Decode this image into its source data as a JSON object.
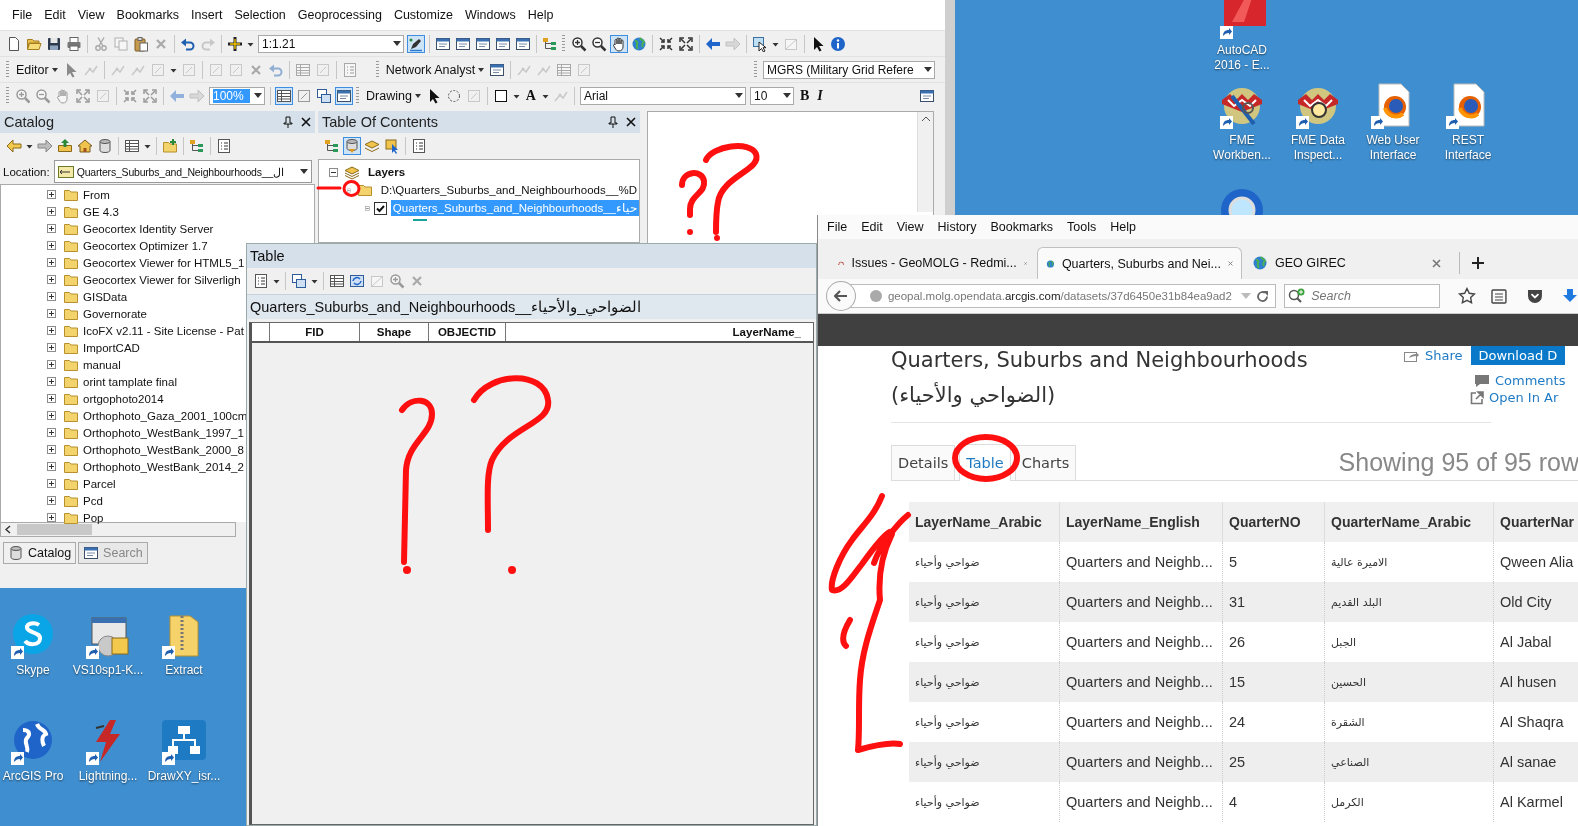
{
  "arcmap": {
    "menu": [
      "File",
      "Edit",
      "View",
      "Bookmarks",
      "Insert",
      "Selection",
      "Geoprocessing",
      "Customize",
      "Windows",
      "Help"
    ],
    "scale": "1:1.21",
    "editor_menu": "Editor",
    "network_analyst_menu": "Network Analyst",
    "coordinate_system": "MGRS (Military Grid Refere",
    "zoom_percent": "100%",
    "drawing_menu": "Drawing",
    "text_tool_button": "A",
    "font": "Arial",
    "font_size": "10",
    "bold_button": "B",
    "italic_button": "I"
  },
  "catalog": {
    "title": "Catalog",
    "location_label": "Location:",
    "location": "Quarters_Suburbs_and_Neighbourhoods__ال",
    "items": [
      {
        "name": "From",
        "expanded": false
      },
      {
        "name": "GE 4.3",
        "expanded": false
      },
      {
        "name": "Geocortex Identity Server",
        "expanded": false
      },
      {
        "name": "Geocortex Optimizer 1.7",
        "expanded": false
      },
      {
        "name": "Geocortex Viewer for HTML5_1",
        "expanded": false
      },
      {
        "name": "Geocortex Viewer for Silverligh",
        "expanded": false
      },
      {
        "name": "GISData",
        "expanded": false
      },
      {
        "name": "Governorate",
        "expanded": false
      },
      {
        "name": "IcoFX v2.11 - Site License - Pat",
        "expanded": false
      },
      {
        "name": "ImportCAD",
        "expanded": false
      },
      {
        "name": "manual",
        "expanded": false
      },
      {
        "name": "orint tamplate final",
        "expanded": false
      },
      {
        "name": "ortgophoto2014",
        "expanded": false
      },
      {
        "name": "Orthophoto_Gaza_2001_100cm",
        "expanded": false
      },
      {
        "name": "Orthophoto_WestBank_1997_1",
        "expanded": false
      },
      {
        "name": "Orthophoto_WestBank_2000_8",
        "expanded": false
      },
      {
        "name": "Orthophoto_WestBank_2014_2",
        "expanded": false
      },
      {
        "name": "Parcel",
        "expanded": false
      },
      {
        "name": "Pcd",
        "expanded": false
      },
      {
        "name": "Pop",
        "expanded": false
      }
    ],
    "tabs": [
      {
        "label": "Catalog",
        "selected": true
      },
      {
        "label": "Search",
        "selected": false
      }
    ]
  },
  "table_of_contents": {
    "title": "Table Of Contents",
    "tree": [
      {
        "label": "Layers",
        "expanded": true,
        "children": [
          {
            "label": "D:\\Quarters_Suburbs_and_Neighbourhoods__%D",
            "expanded": true,
            "children": [
              {
                "label": "Quarters_Suburbs_and_Neighbourhoods__حياء",
                "expanded": true,
                "checked": true,
                "selected": true
              }
            ]
          }
        ]
      }
    ]
  },
  "table_window": {
    "title": "Table",
    "layer_tab": "Quarters_Suburbs_and_Neighbourhoods__الضواحي_والأحياء",
    "columns": [
      "FID",
      "Shape",
      "OBJECTID",
      "LayerName_"
    ]
  },
  "browser": {
    "menu": [
      "File",
      "Edit",
      "View",
      "History",
      "Bookmarks",
      "Tools",
      "Help"
    ],
    "tabs": [
      {
        "title": "Issues - GeoMOLG - Redmi...",
        "selected": false
      },
      {
        "title": "Quarters, Suburbs and Nei...",
        "selected": true
      },
      {
        "title": "GEO GIREC",
        "selected": false
      }
    ],
    "url": "geopal.molg.opendata.**arcgis.com**/datasets/37d6450e31b84ea9ad2",
    "search_placeholder": "Search",
    "page": {
      "title": "Quarters, Suburbs and Neighbourhoods",
      "subtitle": "(الضواحي والأحياء)",
      "share": "Share",
      "download": "Download D",
      "comments": "Comments",
      "open_in": "Open In Ar",
      "tabs": [
        {
          "label": "Details",
          "selected": false
        },
        {
          "label": "Table",
          "selected": true
        },
        {
          "label": "Charts",
          "selected": false
        }
      ],
      "showing": "Showing 95 of 95 row",
      "columns": [
        "LayerName_Arabic",
        "LayerName_English",
        "QuarterNO",
        "QuarterName_Arabic",
        "QuarterNar"
      ],
      "rows": [
        [
          "ضواحي وأحياء",
          "Quarters and Neighb...",
          "5",
          "الاميرة عالية",
          "Qween Alia"
        ],
        [
          "ضواحي وأحياء",
          "Quarters and Neighb...",
          "31",
          "البلد القديم",
          "Old City"
        ],
        [
          "ضواحي وأحياء",
          "Quarters and Neighb...",
          "26",
          "الجبل",
          "Al Jabal"
        ],
        [
          "ضواحي وأحياء",
          "Quarters and Neighb...",
          "15",
          "الحسين",
          "Al husen"
        ],
        [
          "ضواحي وأحياء",
          "Quarters and Neighb...",
          "24",
          "الشقرة",
          "Al Shaqra"
        ],
        [
          "ضواحي وأحياء",
          "Quarters and Neighb...",
          "25",
          "الصناعي",
          "Al sanae"
        ],
        [
          "ضواحي وأحياء",
          "Quarters and Neighb...",
          "4",
          "الكرمل",
          "Al Karmel"
        ]
      ]
    }
  },
  "desktop": {
    "icons": [
      {
        "label": "AutoCAD 2016 - E..."
      },
      {
        "label": "FME Workben..."
      },
      {
        "label": "FME Data Inspect..."
      },
      {
        "label": "Web User Interface"
      },
      {
        "label": "REST Interface"
      },
      {
        "label": "Skype"
      },
      {
        "label": "VS10sp1-K..."
      },
      {
        "label": "Extract"
      },
      {
        "label": "ArcGIS Pro"
      },
      {
        "label": "Lightning..."
      },
      {
        "label": "DrawXY_isr..."
      }
    ]
  }
}
